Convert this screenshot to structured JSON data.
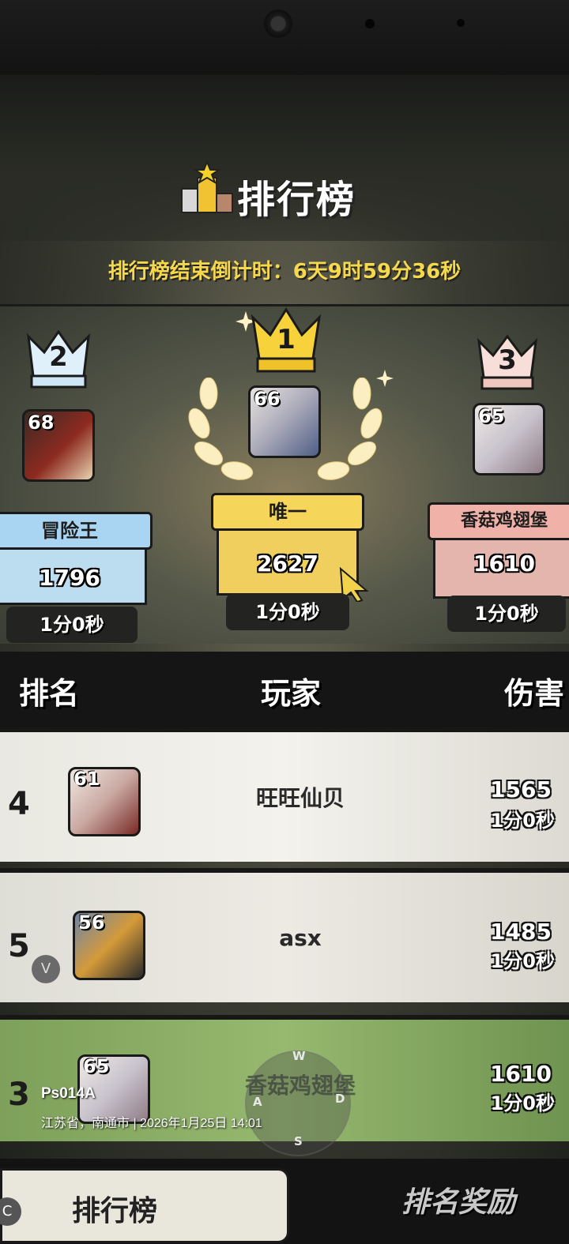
{
  "header": {
    "title": "排行榜",
    "countdown": "排行榜结束倒计时：6天9时59分36秒"
  },
  "podium": {
    "first": {
      "rank": "1",
      "level": "66",
      "name": "唯一",
      "score": "2627",
      "time": "1分0秒",
      "color": "#f2c94c"
    },
    "second": {
      "rank": "2",
      "level": "68",
      "name": "冒险王",
      "score": "1796",
      "time": "1分0秒",
      "color": "#a9d4f2"
    },
    "third": {
      "rank": "3",
      "level": "65",
      "name": "香菇鸡翅堡",
      "score": "1610",
      "time": "1分0秒",
      "color": "#f0b2a8"
    }
  },
  "table": {
    "headers": {
      "rank": "排名",
      "player": "玩家",
      "damage": "伤害"
    },
    "rows": [
      {
        "rank": "4",
        "level": "61",
        "name": "旺旺仙贝",
        "damage": "1565",
        "time": "1分0秒"
      },
      {
        "rank": "5",
        "level": "56",
        "name": "asx",
        "damage": "1485",
        "time": "1分0秒",
        "badge": "V"
      },
      {
        "rank": "3",
        "level": "65",
        "name": "香菇鸡翅堡",
        "damage": "1610",
        "time": "1分0秒",
        "highlight": true
      }
    ]
  },
  "joystick": {
    "up": "W",
    "left": "A",
    "right": "D",
    "down": "S"
  },
  "tabs": {
    "leaderboard": "排行榜",
    "rewards": "排名奖励",
    "corner_badge": "C"
  },
  "watermark": {
    "device": "Ps014A",
    "location_time": "江苏省，南通市 | 2026年1月25日 14:01"
  },
  "icons": [
    "podium-trophy-icon",
    "crown-icon",
    "laurel-icon",
    "pointer-cursor-icon",
    "sparkle-icon"
  ]
}
